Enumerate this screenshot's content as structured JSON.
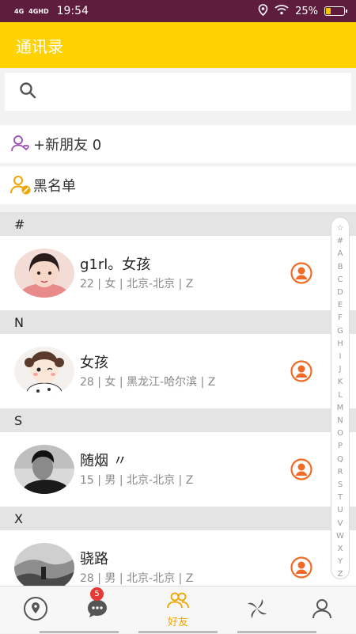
{
  "status_bar": {
    "network": [
      "4G",
      "4GHD"
    ],
    "time": "19:54",
    "battery": "25%",
    "battery_level": 0.25,
    "icons": [
      "location-icon",
      "wifi-icon"
    ]
  },
  "header": {
    "title": "通讯录"
  },
  "search": {
    "placeholder": "",
    "icon": "search-icon"
  },
  "menu": {
    "new_friends": {
      "label": "+新朋友 0",
      "icon": "add-friend-icon"
    },
    "blacklist": {
      "label": "黑名单",
      "icon": "blacklist-icon"
    }
  },
  "sections": [
    {
      "letter": "#",
      "contacts": [
        {
          "name": "g1rl。女孩",
          "info": "22 | 女 | 北京-北京 | Z"
        }
      ]
    },
    {
      "letter": "N",
      "contacts": [
        {
          "name": "女孩",
          "info": "28 | 女 | 黑龙江-哈尔滨 | Z"
        }
      ]
    },
    {
      "letter": "S",
      "contacts": [
        {
          "name": "随烟 〃",
          "info": "15 | 男 | 北京-北京 | Z"
        }
      ]
    },
    {
      "letter": "X",
      "contacts": [
        {
          "name": "骁路",
          "info": "28 | 男 | 北京-北京 | Z"
        }
      ]
    }
  ],
  "index_letters": [
    "☆",
    "#",
    "A",
    "B",
    "C",
    "D",
    "E",
    "F",
    "G",
    "H",
    "I",
    "J",
    "K",
    "L",
    "M",
    "N",
    "O",
    "P",
    "Q",
    "R",
    "S",
    "T",
    "U",
    "V",
    "W",
    "X",
    "Y",
    "Z"
  ],
  "tabs": [
    {
      "icon": "location-icon",
      "label": ""
    },
    {
      "icon": "chat-icon",
      "label": "",
      "badge": "5"
    },
    {
      "icon": "friends-icon",
      "label": "好友",
      "active": true
    },
    {
      "icon": "pinwheel-icon",
      "label": ""
    },
    {
      "icon": "profile-icon",
      "label": ""
    }
  ],
  "colors": {
    "status_bar": "#5e1d3c",
    "accent": "#ffd200",
    "active_tab": "#f0a400",
    "contact_button": "#f06a28",
    "badge": "#e53935"
  }
}
